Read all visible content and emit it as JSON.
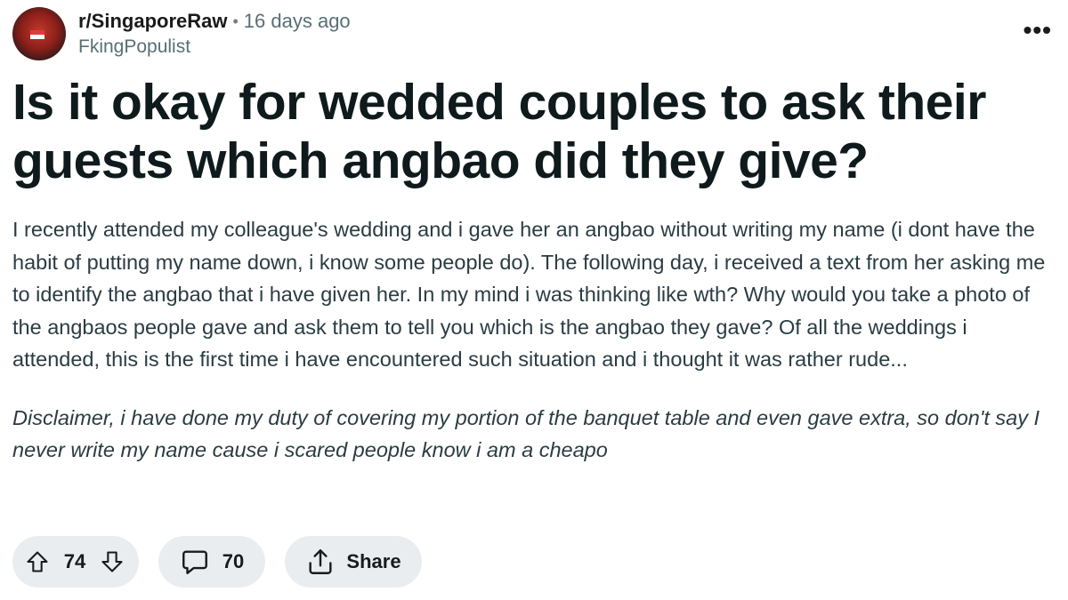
{
  "post": {
    "subreddit": "r/SingaporeRaw",
    "separator": "•",
    "time": "16 days ago",
    "author": "FkingPopulist",
    "more_label": "•••",
    "title": "Is it okay for wedded couples to ask their guests which angbao did they give?",
    "body_paragraphs": [
      "I recently attended my colleague's wedding and i gave her an angbao without writing my name (i dont have the habit of putting my name down, i know some people do). The following day, i received a text from her asking me to identify the angbao that i have given her. In my mind i was thinking like wth? Why would you take a photo of the angbaos people gave and ask them to tell you which is the angbao they gave? Of all the weddings i attended, this is the first time i have encountered such situation and i thought it was rather rude...",
      "Disclaimer, i have done my duty of covering my portion of the banquet table and even gave extra, so don't say I never write my name cause i scared people know i am a cheapo"
    ]
  },
  "actions": {
    "vote_count": "74",
    "comment_count": "70",
    "share_label": "Share"
  },
  "icons": {
    "upvote": "arrow-up-icon",
    "downvote": "arrow-down-icon",
    "comment": "comment-bubble-icon",
    "share": "share-icon",
    "more": "more-options-icon"
  },
  "colors": {
    "pill_background": "#eaedef",
    "title": "#0f1a1c",
    "meta_gray": "#576f76"
  }
}
